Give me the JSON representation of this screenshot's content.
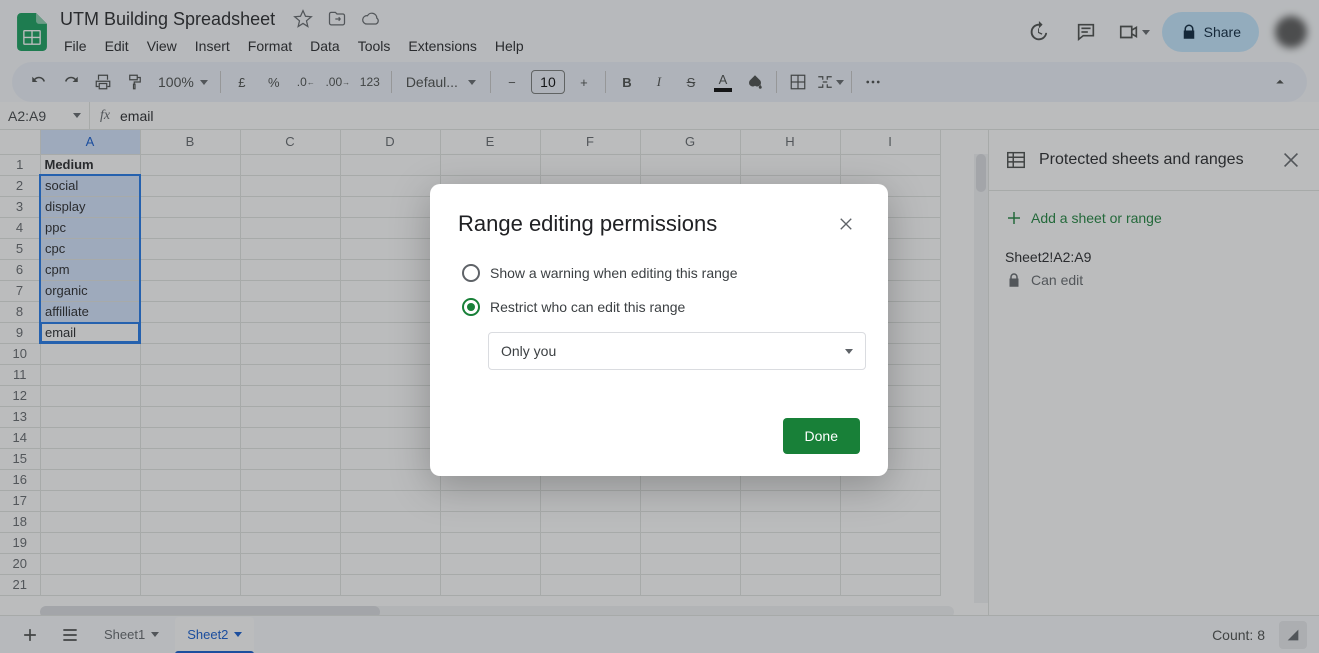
{
  "doc": {
    "title": "UTM Building Spreadsheet"
  },
  "menus": [
    "File",
    "Edit",
    "View",
    "Insert",
    "Format",
    "Data",
    "Tools",
    "Extensions",
    "Help"
  ],
  "share_label": "Share",
  "toolbar": {
    "zoom": "100%",
    "font": "Defaul...",
    "fontsize": "10"
  },
  "name_box": "A2:A9",
  "formula": "email",
  "columns": [
    "A",
    "B",
    "C",
    "D",
    "E",
    "F",
    "G",
    "H",
    "I"
  ],
  "rows": [
    "1",
    "2",
    "3",
    "4",
    "5",
    "6",
    "7",
    "8",
    "9",
    "10",
    "11",
    "12",
    "13",
    "14",
    "15",
    "16",
    "17",
    "18",
    "19",
    "20",
    "21"
  ],
  "colA": [
    "Medium",
    "social",
    "display",
    "ppc",
    "cpc",
    "cpm",
    "organic",
    "affilliate",
    "email"
  ],
  "sidepanel": {
    "title": "Protected sheets and ranges",
    "add": "Add a sheet or range",
    "range_name": "Sheet2!A2:A9",
    "range_sub": "Can edit"
  },
  "tabs": {
    "sheet1": "Sheet1",
    "sheet2": "Sheet2"
  },
  "status": {
    "count": "Count: 8"
  },
  "dialog": {
    "title": "Range editing permissions",
    "opt_warn": "Show a warning when editing this range",
    "opt_restrict": "Restrict who can edit this range",
    "select_value": "Only you",
    "done": "Done"
  }
}
